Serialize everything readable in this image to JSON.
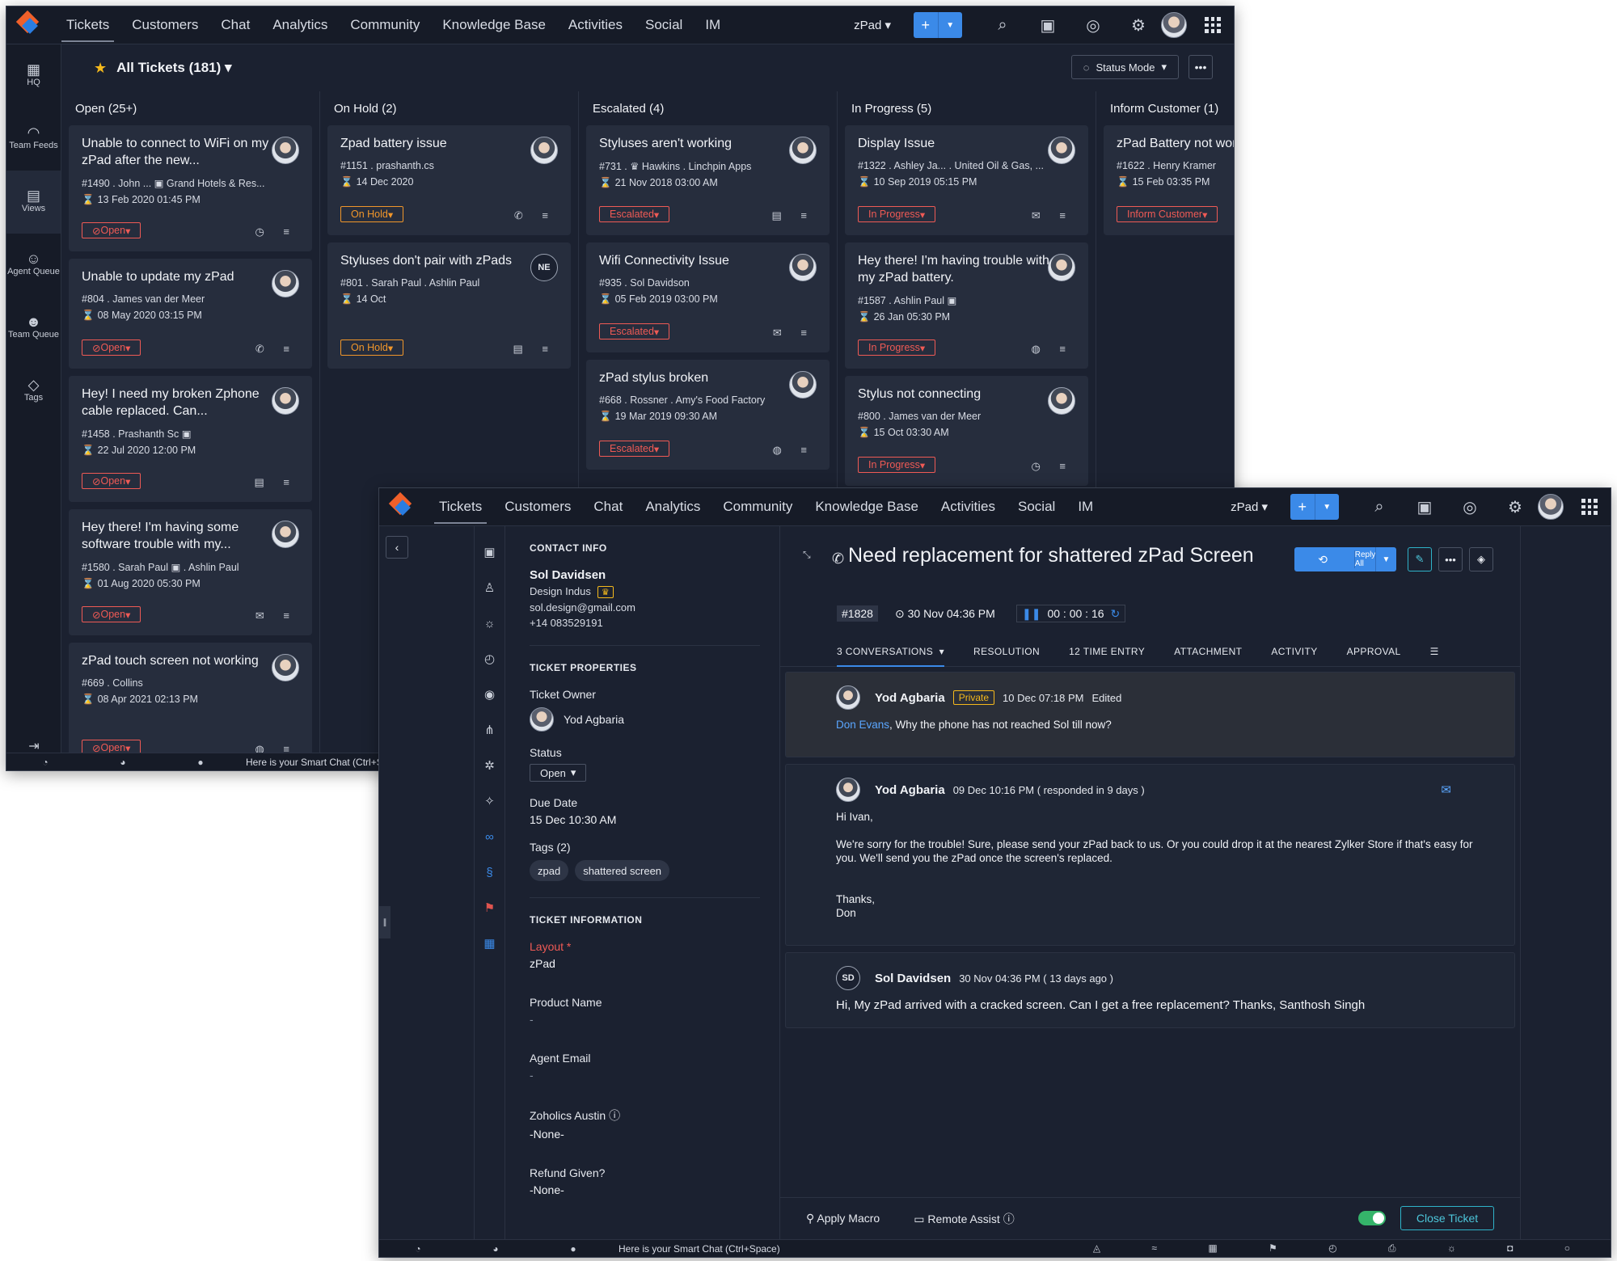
{
  "window1": {
    "nav": [
      "Tickets",
      "Customers",
      "Chat",
      "Analytics",
      "Community",
      "Knowledge Base",
      "Activities",
      "Social",
      "IM"
    ],
    "department": "zPad",
    "sidebar": [
      {
        "label": "HQ",
        "icon": "hq-icon",
        "glyph": "▦"
      },
      {
        "label": "Team Feeds",
        "icon": "feeds-icon",
        "glyph": "◠"
      },
      {
        "label": "Views",
        "icon": "views-icon",
        "glyph": "▤"
      },
      {
        "label": "Agent Queue",
        "icon": "agent-queue-icon",
        "glyph": "☺"
      },
      {
        "label": "Team Queue",
        "icon": "team-queue-icon",
        "glyph": "☻"
      },
      {
        "label": "Tags",
        "icon": "tags-icon",
        "glyph": "◇"
      }
    ],
    "view_title": "All Tickets (181)",
    "status_mode": "Status Mode",
    "columns": [
      {
        "title": "Open (25+)",
        "cards": [
          {
            "title": "Unable to connect to WiFi on my zPad after the new...",
            "meta": "#1490  .  John ...  ▣  Grand Hotels & Res...",
            "date": "13 Feb 2020 01:45 PM",
            "status": "Open"
          },
          {
            "title": "Unable to update my zPad",
            "meta": "#804  .  James van der Meer",
            "date": "08 May 2020 03:15 PM",
            "status": "Open"
          },
          {
            "title": "Hey! I need my broken Zphone cable replaced. Can...",
            "meta": "#1458  .  Prashanth Sc  ▣",
            "date": "22 Jul 2020 12:00 PM",
            "status": "Open"
          },
          {
            "title": "Hey there! I'm having some software trouble with my...",
            "meta": "#1580  .  Sarah Paul  ▣  .  Ashlin Paul",
            "date": "01 Aug 2020 05:30 PM",
            "status": "Open"
          },
          {
            "title": "zPad touch screen not working",
            "meta": "#669  .  Collins",
            "date": "08 Apr 2021 02:13 PM",
            "status": "Open"
          }
        ]
      },
      {
        "title": "On Hold (2)",
        "cards": [
          {
            "title": "Zpad battery issue",
            "meta": "#1151  .  prashanth.cs",
            "date": "14 Dec 2020",
            "status": "On Hold"
          },
          {
            "title": "Styluses don't pair with zPads",
            "meta": "#801  .  Sarah Paul  .  Ashlin Paul",
            "date": "14 Oct",
            "status": "On Hold",
            "initials": "NE"
          }
        ]
      },
      {
        "title": "Escalated (4)",
        "cards": [
          {
            "title": "Styluses aren't working",
            "meta": "#731  .  ♛ Hawkins  .  Linchpin Apps",
            "date": "21 Nov 2018 03:00 AM",
            "status": "Escalated"
          },
          {
            "title": "Wifi Connectivity Issue",
            "meta": "#935  .  Sol Davidson",
            "date": "05 Feb 2019 03:00 PM",
            "status": "Escalated"
          },
          {
            "title": "zPad stylus broken",
            "meta": "#668  .  Rossner  .  Amy's Food Factory",
            "date": "19 Mar 2019 09:30 AM",
            "status": "Escalated"
          }
        ]
      },
      {
        "title": "In Progress (5)",
        "cards": [
          {
            "title": "Display Issue",
            "meta": "#1322  .  Ashley Ja...  .  United Oil & Gas, ...",
            "date": "10 Sep 2019 05:15 PM",
            "status": "In Progress"
          },
          {
            "title": "Hey there! I'm having trouble with my zPad battery.",
            "meta": "#1587  .  Ashlin Paul  ▣",
            "date": "26 Jan 05:30 PM",
            "status": "In Progress"
          },
          {
            "title": "Stylus not connecting",
            "meta": "#800  .  James van der Meer",
            "date": "15 Oct 03:30 AM",
            "status": "In Progress"
          }
        ]
      },
      {
        "title": "Inform Customer (1)",
        "cards": [
          {
            "title": "zPad Battery not working",
            "meta": "#1622  .  Henry Kramer",
            "date": "15 Feb 03:35 PM",
            "status": "Inform Customer"
          }
        ]
      }
    ],
    "smart_chat": "Here is your Smart Chat (Ctrl+Space)"
  },
  "window2": {
    "nav": [
      "Tickets",
      "Customers",
      "Chat",
      "Analytics",
      "Community",
      "Knowledge Base",
      "Activities",
      "Social",
      "IM"
    ],
    "department": "zPad",
    "contact": {
      "section": "CONTACT INFO",
      "name": "Sol Davidsen",
      "company": "Design Indus",
      "email": "sol.design@gmail.com",
      "phone": "+14 083529191"
    },
    "properties": {
      "section": "TICKET PROPERTIES",
      "owner_label": "Ticket Owner",
      "owner": "Yod Agbaria",
      "status_label": "Status",
      "status": "Open",
      "due_label": "Due Date",
      "due": "15 Dec 10:30 AM",
      "tags_label": "Tags (2)",
      "tags": [
        "zpad",
        "shattered screen"
      ]
    },
    "info": {
      "section": "TICKET INFORMATION",
      "layout_label": "Layout",
      "layout": "zPad",
      "product_label": "Product Name",
      "product": "-",
      "agent_email_label": "Agent Email",
      "agent_email": "-",
      "zoholics_label": "Zoholics Austin",
      "zoholics": "-None-",
      "refund_label": "Refund Given?",
      "refund": "-None-"
    },
    "ticket": {
      "title": "Need replacement for shattered zPad Screen",
      "id": "#1828",
      "created": "30 Nov 04:36 PM",
      "timer": "00 : 00 : 16",
      "reply_all": "Reply All"
    },
    "tabs": [
      "3 CONVERSATIONS",
      "RESOLUTION",
      "12 TIME ENTRY",
      "ATTACHMENT",
      "ACTIVITY",
      "APPROVAL"
    ],
    "conversations": [
      {
        "author": "Yod Agbaria",
        "badge": "Private",
        "time": "10 Dec 07:18 PM",
        "extra": "Edited",
        "mention": "Don Evans",
        "body": ", Why the phone has not reached Sol till now?"
      },
      {
        "author": "Yod Agbaria",
        "time": "09 Dec 10:16 PM ( responded in 9 days )",
        "greeting": "Hi Ivan,",
        "para": "We're sorry for the trouble! Sure, please send your zPad back to us. Or you could drop it at the nearest Zylker Store if that's easy for you. We'll send you the zPad once the screen's replaced.",
        "sign1": "Thanks,",
        "sign2": "Don"
      },
      {
        "author": "Sol Davidsen",
        "initials": "SD",
        "time": "30 Nov 04:36 PM ( 13 days ago )",
        "body": "Hi, My zPad arrived with a cracked screen. Can I get a free replacement? Thanks, Santhosh Singh"
      }
    ],
    "footer": {
      "apply_macro": "Apply Macro",
      "remote_assist": "Remote Assist",
      "close_ticket": "Close Ticket"
    },
    "smart_chat": "Here is your Smart Chat (Ctrl+Space)"
  }
}
